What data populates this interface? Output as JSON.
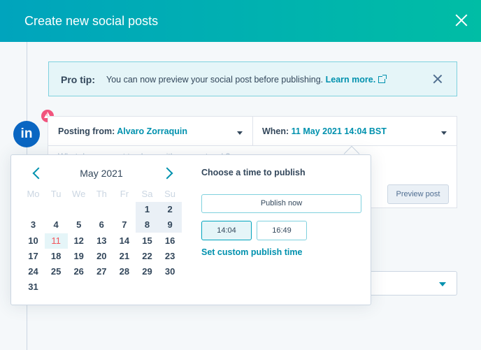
{
  "header": {
    "title": "Create new social posts"
  },
  "tip": {
    "label": "Pro tip:",
    "text": "You can now preview your social post before publishing. ",
    "link": "Learn more."
  },
  "post": {
    "network_avatar_text": "in",
    "posting_from_label": "Posting from: ",
    "posting_from_value": "Alvaro Zorraquin",
    "when_label": "When: ",
    "when_value": "11 May 2021 14:04 BST",
    "compose_placeholder": "What do you want to share with your network?",
    "preview_button": "Preview post"
  },
  "calendar": {
    "month_label": "May 2021",
    "weekdays": [
      "Mo",
      "Tu",
      "We",
      "Th",
      "Fr",
      "Sa",
      "Su"
    ],
    "weeks": [
      [
        "",
        "",
        "",
        "",
        "",
        "1",
        "2"
      ],
      [
        "3",
        "4",
        "5",
        "6",
        "7",
        "8",
        "9"
      ],
      [
        "10",
        "11",
        "12",
        "13",
        "14",
        "15",
        "16"
      ],
      [
        "17",
        "18",
        "19",
        "20",
        "21",
        "22",
        "23"
      ],
      [
        "24",
        "25",
        "26",
        "27",
        "28",
        "29",
        "30"
      ],
      [
        "31",
        "",
        "",
        "",
        "",
        "",
        ""
      ]
    ],
    "selected_day": "11"
  },
  "time_picker": {
    "title": "Choose a time to publish",
    "publish_now": "Publish now",
    "option_selected": "14:04",
    "option_alt": "16:49",
    "custom_link": "Set custom publish time"
  },
  "colors": {
    "brand_teal": "#00a4bd",
    "link": "#0091ae",
    "today": "#f2545b",
    "linkedin": "#0a66c2"
  }
}
